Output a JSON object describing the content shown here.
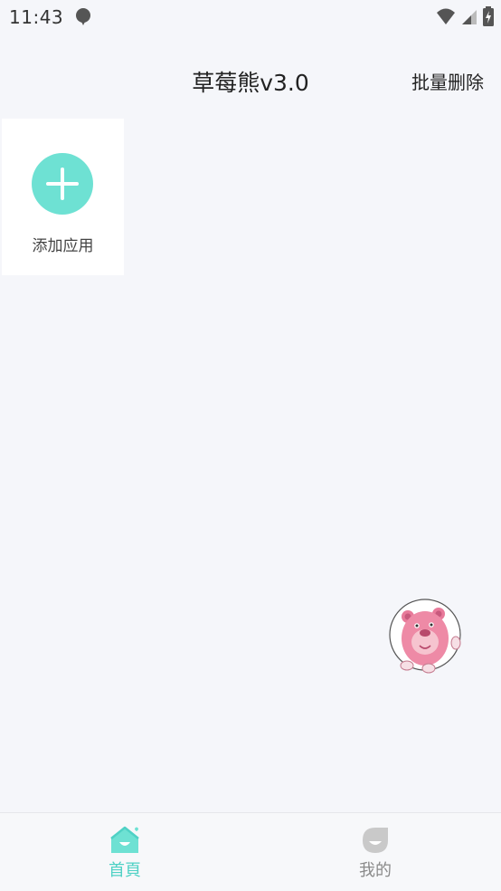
{
  "status_bar": {
    "time": "11:43",
    "icons": [
      "notification-balloon-icon",
      "wifi-icon",
      "cell-signal-icon",
      "battery-charging-icon"
    ]
  },
  "header": {
    "title": "草莓熊v3.0",
    "action_label": "批量删除"
  },
  "add_app": {
    "label": "添加应用",
    "icon": "plus-icon"
  },
  "floating_button": {
    "icon": "strawberry-bear-icon"
  },
  "bottom_nav": {
    "items": [
      {
        "label": "首頁",
        "icon": "home-icon",
        "active": true
      },
      {
        "label": "我的",
        "icon": "profile-icon",
        "active": false
      }
    ]
  },
  "colors": {
    "accent": "#6ee1d3",
    "nav_active": "#4fd1c5",
    "nav_inactive": "#8a8a8a",
    "background": "#f5f6fa"
  }
}
